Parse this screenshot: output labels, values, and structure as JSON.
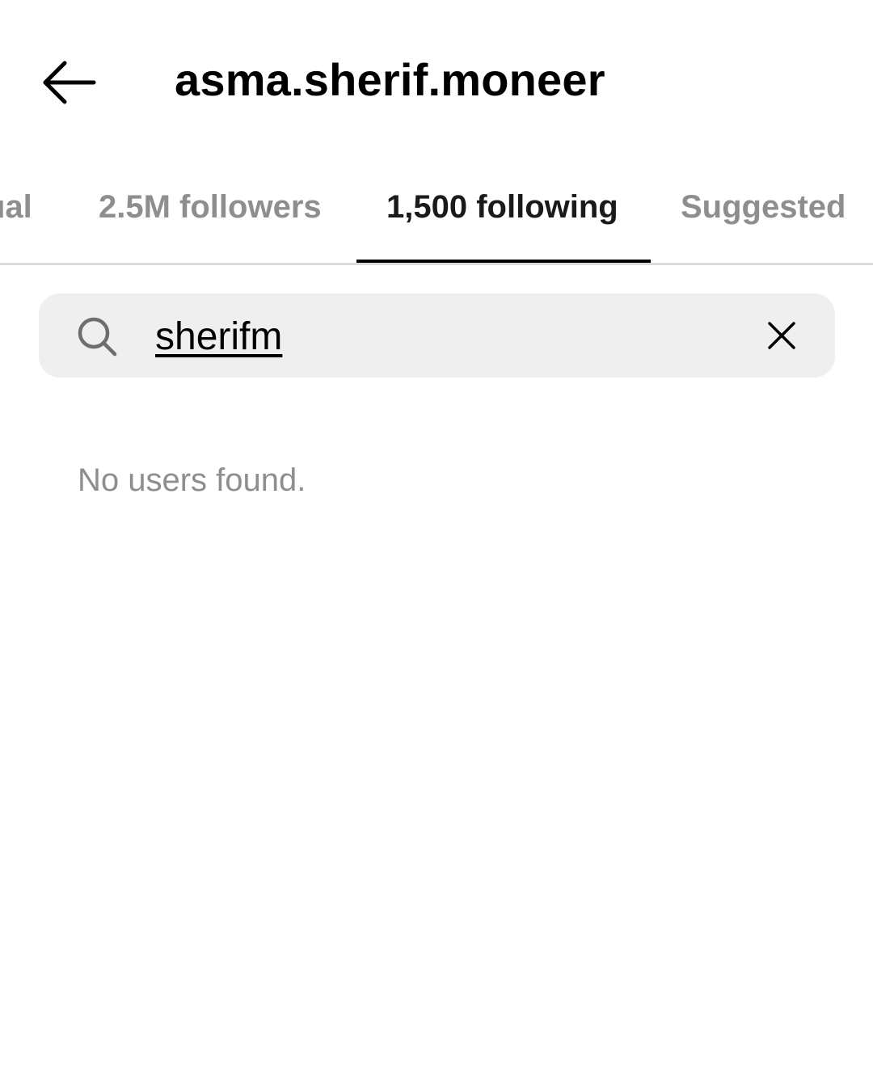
{
  "header": {
    "back_icon": "arrow-left-icon",
    "title": "asma.sherif.moneer"
  },
  "tabs": [
    {
      "label": "Mutual",
      "visible_label": "ual",
      "active": false
    },
    {
      "label": "2.5M followers",
      "active": false
    },
    {
      "label": "1,500 following",
      "active": true
    },
    {
      "label": "Suggested",
      "active": false
    }
  ],
  "search": {
    "icon": "search-icon",
    "value": "sherifm",
    "clear_icon": "close-icon"
  },
  "results": {
    "empty_message": "No users found."
  },
  "colors": {
    "text_primary": "#000000",
    "text_muted": "#8e8e8e",
    "search_background": "#efefef",
    "divider": "#dbdbdb"
  }
}
